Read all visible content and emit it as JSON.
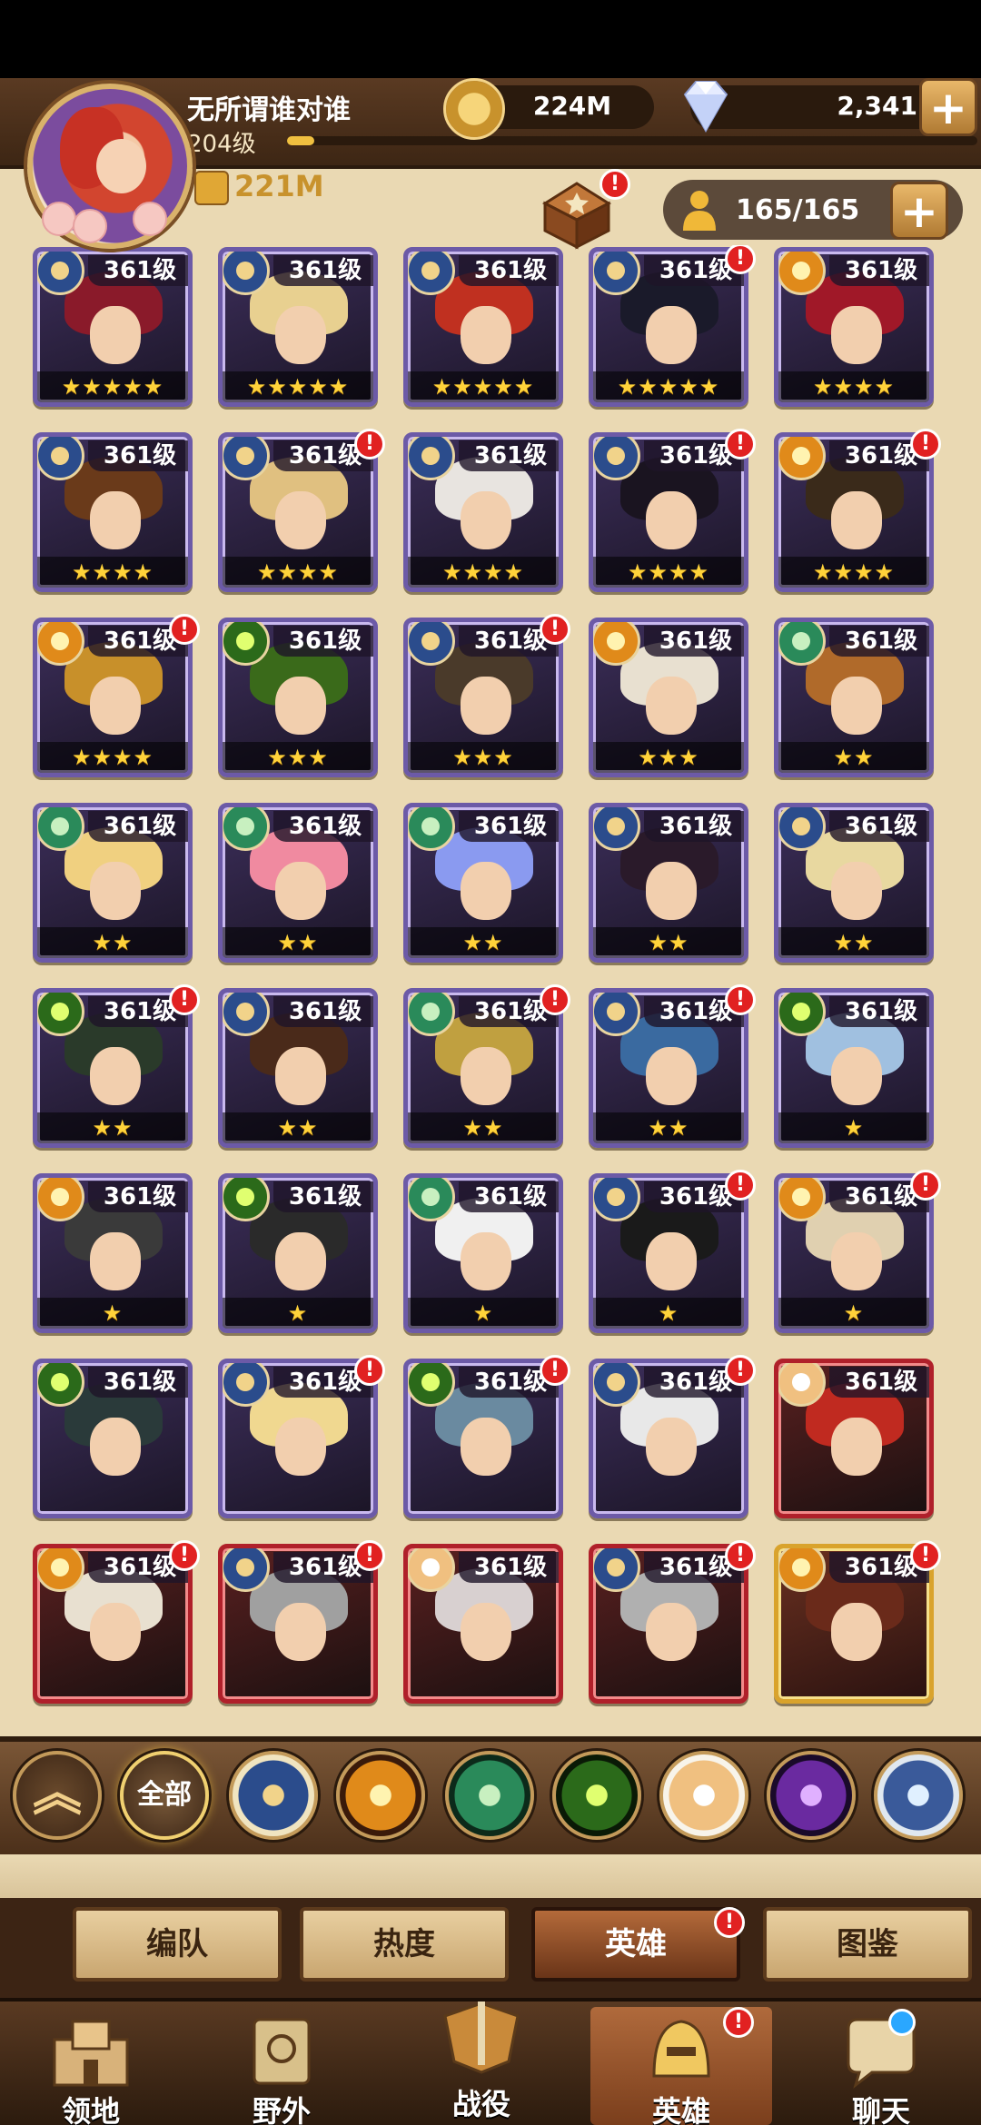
{
  "header": {
    "player_name": "无所谓谁对谁",
    "player_level": "204级",
    "xp_progress": 0.04,
    "gold": "224M",
    "gems": "2,341",
    "power": "221M",
    "roster_count": "165/165",
    "plus_label": "+"
  },
  "heroes": [
    {
      "level": "361级",
      "stars": "★★★★★",
      "faction": "lightbearer",
      "frame": "purple",
      "alert": false,
      "hair": "#8a1a2a"
    },
    {
      "level": "361级",
      "stars": "★★★★★",
      "faction": "lightbearer",
      "frame": "purple",
      "alert": false,
      "hair": "#e8d090"
    },
    {
      "level": "361级",
      "stars": "★★★★★",
      "faction": "lightbearer",
      "frame": "purple",
      "alert": false,
      "hair": "#c03020"
    },
    {
      "level": "361级",
      "stars": "★★★★★",
      "faction": "lightbearer",
      "frame": "purple",
      "alert": true,
      "hair": "#1a1a2a"
    },
    {
      "level": "361级",
      "stars": "★★★★",
      "faction": "mauler",
      "frame": "purple",
      "alert": false,
      "hair": "#a01828"
    },
    {
      "level": "361级",
      "stars": "★★★★",
      "faction": "lightbearer",
      "frame": "purple",
      "alert": false,
      "hair": "#6a3a1a"
    },
    {
      "level": "361级",
      "stars": "★★★★",
      "faction": "lightbearer",
      "frame": "purple",
      "alert": true,
      "hair": "#e0c080"
    },
    {
      "level": "361级",
      "stars": "★★★★",
      "faction": "lightbearer",
      "frame": "purple",
      "alert": false,
      "hair": "#e8e4e0"
    },
    {
      "level": "361级",
      "stars": "★★★★",
      "faction": "lightbearer",
      "frame": "purple",
      "alert": true,
      "hair": "#1a1420"
    },
    {
      "level": "361级",
      "stars": "★★★★",
      "faction": "mauler",
      "frame": "purple",
      "alert": true,
      "hair": "#3a2a1a"
    },
    {
      "level": "361级",
      "stars": "★★★★",
      "faction": "mauler",
      "frame": "purple",
      "alert": true,
      "hair": "#c8902a"
    },
    {
      "level": "361级",
      "stars": "★★★",
      "faction": "graveborn",
      "frame": "purple",
      "alert": false,
      "hair": "#3a6a1a"
    },
    {
      "level": "361级",
      "stars": "★★★",
      "faction": "lightbearer",
      "frame": "purple",
      "alert": true,
      "hair": "#4a3a2a"
    },
    {
      "level": "361级",
      "stars": "★★★",
      "faction": "mauler",
      "frame": "purple",
      "alert": false,
      "hair": "#e8e0d0"
    },
    {
      "level": "361级",
      "stars": "★★",
      "faction": "wilder",
      "frame": "purple",
      "alert": false,
      "hair": "#b06a2a"
    },
    {
      "level": "361级",
      "stars": "★★",
      "faction": "wilder",
      "frame": "purple",
      "alert": false,
      "hair": "#f0d080"
    },
    {
      "level": "361级",
      "stars": "★★",
      "faction": "wilder",
      "frame": "purple",
      "alert": false,
      "hair": "#f08aa0"
    },
    {
      "level": "361级",
      "stars": "★★",
      "faction": "wilder",
      "frame": "purple",
      "alert": false,
      "hair": "#8a9af0"
    },
    {
      "level": "361级",
      "stars": "★★",
      "faction": "lightbearer",
      "frame": "purple",
      "alert": false,
      "hair": "#2a1a2a"
    },
    {
      "level": "361级",
      "stars": "★★",
      "faction": "lightbearer",
      "frame": "purple",
      "alert": false,
      "hair": "#e8d8a0"
    },
    {
      "level": "361级",
      "stars": "★★",
      "faction": "graveborn",
      "frame": "purple",
      "alert": true,
      "hair": "#2a3a2a"
    },
    {
      "level": "361级",
      "stars": "★★",
      "faction": "lightbearer",
      "frame": "purple",
      "alert": false,
      "hair": "#4a2a1a"
    },
    {
      "level": "361级",
      "stars": "★★",
      "faction": "wilder",
      "frame": "purple",
      "alert": true,
      "hair": "#c0a040"
    },
    {
      "level": "361级",
      "stars": "★★",
      "faction": "lightbearer",
      "frame": "purple",
      "alert": true,
      "hair": "#3a6aa0"
    },
    {
      "level": "361级",
      "stars": "★",
      "faction": "graveborn",
      "frame": "purple",
      "alert": false,
      "hair": "#a0c0e0"
    },
    {
      "level": "361级",
      "stars": "★",
      "faction": "mauler",
      "frame": "purple",
      "alert": false,
      "hair": "#3a3a3a"
    },
    {
      "level": "361级",
      "stars": "★",
      "faction": "graveborn",
      "frame": "purple",
      "alert": false,
      "hair": "#2a2a2a"
    },
    {
      "level": "361级",
      "stars": "★",
      "faction": "wilder",
      "frame": "purple",
      "alert": false,
      "hair": "#f0f0f0"
    },
    {
      "level": "361级",
      "stars": "★",
      "faction": "lightbearer",
      "frame": "purple",
      "alert": true,
      "hair": "#1a1a1a"
    },
    {
      "level": "361级",
      "stars": "★",
      "faction": "mauler",
      "frame": "purple",
      "alert": true,
      "hair": "#e0d0b0"
    },
    {
      "level": "361级",
      "stars": "",
      "faction": "graveborn",
      "frame": "purple",
      "alert": false,
      "hair": "#2a3a3a"
    },
    {
      "level": "361级",
      "stars": "",
      "faction": "lightbearer",
      "frame": "purple",
      "alert": true,
      "hair": "#f0d890"
    },
    {
      "level": "361级",
      "stars": "",
      "faction": "graveborn",
      "frame": "purple",
      "alert": true,
      "hair": "#6a8aa0"
    },
    {
      "level": "361级",
      "stars": "",
      "faction": "lightbearer",
      "frame": "purple",
      "alert": true,
      "hair": "#e8e8e8"
    },
    {
      "level": "361级",
      "stars": "",
      "faction": "celestial",
      "frame": "red",
      "alert": false,
      "hair": "#c02a20"
    },
    {
      "level": "361级",
      "stars": "",
      "faction": "mauler",
      "frame": "red",
      "alert": true,
      "hair": "#e8e0d0"
    },
    {
      "level": "361级",
      "stars": "",
      "faction": "lightbearer",
      "frame": "red",
      "alert": true,
      "hair": "#a0a0a0"
    },
    {
      "level": "361级",
      "stars": "",
      "faction": "celestial",
      "frame": "red",
      "alert": false,
      "hair": "#d8d0d0"
    },
    {
      "level": "361级",
      "stars": "",
      "faction": "lightbearer",
      "frame": "red",
      "alert": true,
      "hair": "#b0b0b0"
    },
    {
      "level": "361级",
      "stars": "",
      "faction": "mauler",
      "frame": "gold",
      "alert": true,
      "hair": "#6a2a1a"
    }
  ],
  "faction_filters": {
    "collapse_icon": "double-chevron-up-icon",
    "all_label": "全部",
    "items": [
      "lightbearer-icon",
      "mauler-icon",
      "wilder-icon",
      "graveborn-icon",
      "celestial-icon",
      "hypogean-icon",
      "dimensional-icon"
    ]
  },
  "sub_tabs": [
    {
      "label": "编队",
      "active": false,
      "alert": false
    },
    {
      "label": "热度",
      "active": false,
      "alert": false
    },
    {
      "label": "英雄",
      "active": true,
      "alert": true
    },
    {
      "label": "图鉴",
      "active": false,
      "alert": false
    }
  ],
  "bottom_nav": [
    {
      "label": "领地",
      "icon": "castle-icon",
      "active": false
    },
    {
      "label": "野外",
      "icon": "map-scroll-icon",
      "active": false
    },
    {
      "label": "战役",
      "icon": "sword-shield-icon",
      "active": false
    },
    {
      "label": "英雄",
      "icon": "helmet-icon",
      "active": true,
      "alert": true
    },
    {
      "label": "聊天",
      "icon": "chat-icon",
      "active": false,
      "notify": true
    }
  ],
  "alert_glyph": "!"
}
